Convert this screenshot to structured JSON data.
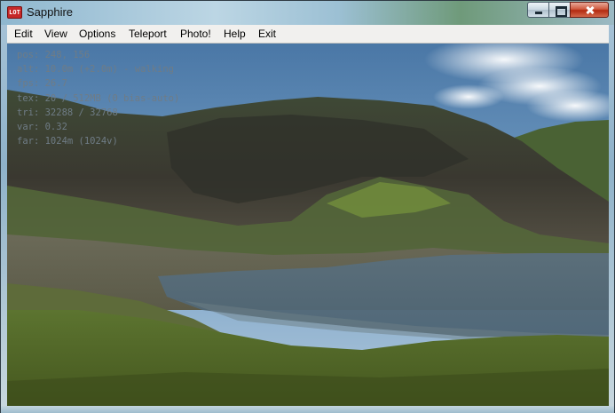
{
  "window": {
    "title": "Sapphire",
    "icon": "app-icon",
    "icon_text": "LOT",
    "controls": [
      "minimize-icon",
      "maximize-icon",
      "close-icon"
    ]
  },
  "menu": {
    "items": [
      "Edit",
      "View",
      "Options",
      "Teleport",
      "Photo!",
      "Help",
      "Exit"
    ]
  },
  "hud": {
    "lines": [
      "pos: 248, 156",
      "alt: 10.0m (+2.0m) - walking",
      "fps: 26.7",
      "tex: 20 / 512MB (0 bias-auto)",
      "tri: 32288 / 32768",
      "var: 0.32",
      "far: 1024m (1024v)"
    ]
  },
  "colors": {
    "sky": "#6a95c0",
    "rock": "#4a4a40",
    "grass": "#4e6a2a",
    "water": "#53697a",
    "hud_text": "#6f7c86"
  }
}
